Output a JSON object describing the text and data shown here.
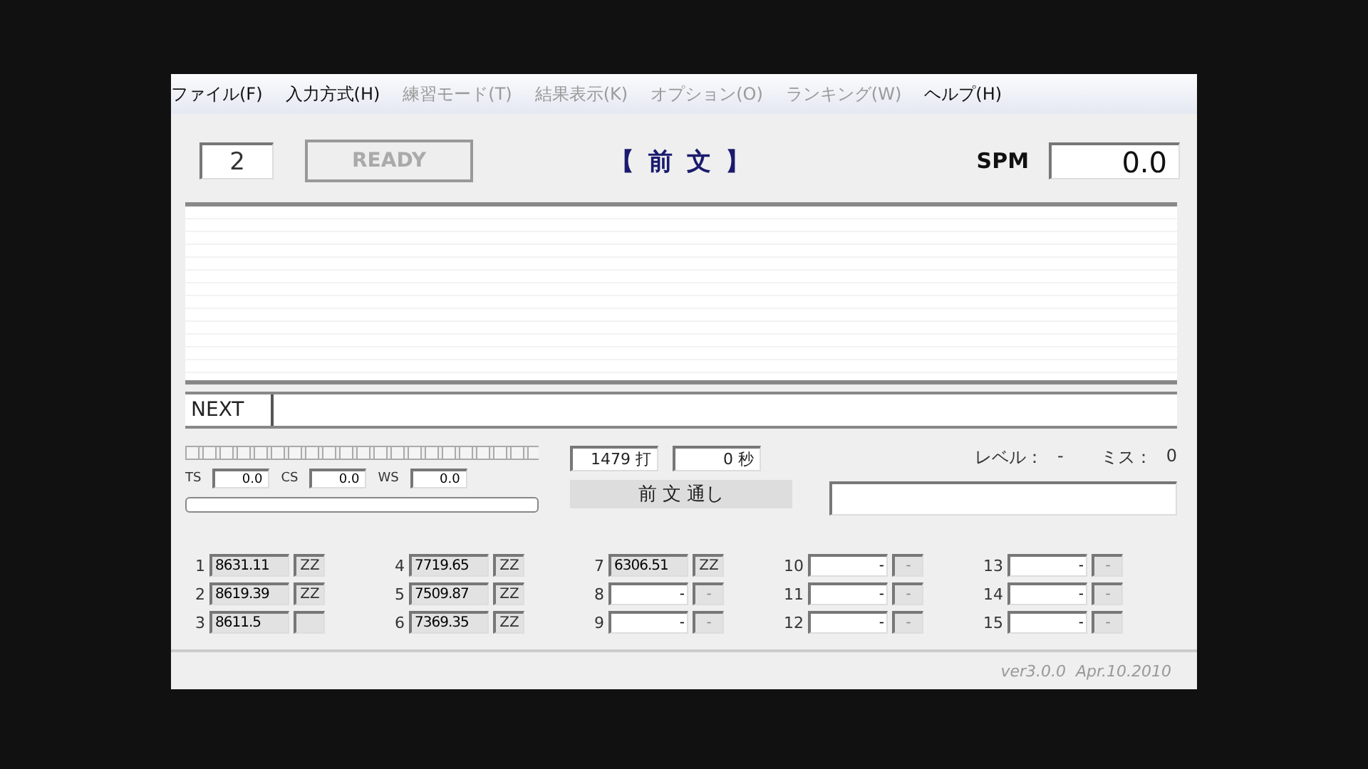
{
  "menu": [
    {
      "label": "ファイル(F)",
      "disabled": false
    },
    {
      "label": "入力方式(H)",
      "disabled": false
    },
    {
      "label": "練習モード(T)",
      "disabled": true
    },
    {
      "label": "結果表示(K)",
      "disabled": true
    },
    {
      "label": "オプション(O)",
      "disabled": true
    },
    {
      "label": "ランキング(W)",
      "disabled": true
    },
    {
      "label": "ヘルプ(H)",
      "disabled": false
    }
  ],
  "header": {
    "count": "2",
    "ready_button": {
      "label": "READY",
      "disabled": true
    },
    "title": "【 前 文 】",
    "spm_label": "SPM",
    "spm_value": "0.0"
  },
  "next_label": "NEXT",
  "speeds": [
    {
      "label": "TS",
      "value": "0.0"
    },
    {
      "label": "CS",
      "value": "0.0"
    },
    {
      "label": "WS",
      "value": "0.0"
    }
  ],
  "segment_meter": {
    "level": 0
  },
  "time_bar": {
    "level": 0
  },
  "keystrokes": "1479 打",
  "seconds": "0 秒",
  "mode_button": "前 文 通し",
  "level_label": "レベル：",
  "level_value": "-",
  "miss_label": "ミス：",
  "miss_value": "0",
  "scores": [
    {
      "rank": "1",
      "value": "8631.11",
      "grade": "ZZ",
      "kind": "record"
    },
    {
      "rank": "2",
      "value": "8619.39",
      "grade": "ZZ",
      "kind": "record"
    },
    {
      "rank": "3",
      "value": "8611.5",
      "kind": "record"
    },
    {
      "rank": "4",
      "value": "7719.65",
      "grade": "ZZ",
      "kind": "record"
    },
    {
      "rank": "5",
      "value": "7509.87",
      "grade": "ZZ",
      "kind": "record"
    },
    {
      "rank": "6",
      "value": "7369.35",
      "grade": "ZZ",
      "kind": "record"
    },
    {
      "rank": "7",
      "value": "6306.51",
      "grade": "ZZ",
      "kind": "record"
    },
    {
      "rank": "8",
      "value": "-",
      "grade": "-",
      "kind": "empty"
    },
    {
      "rank": "9",
      "value": "-",
      "grade": "-",
      "kind": "empty"
    },
    {
      "rank": "10",
      "value": "-",
      "grade": "-",
      "kind": "empty"
    },
    {
      "rank": "11",
      "value": "-",
      "grade": "-",
      "kind": "empty"
    },
    {
      "rank": "12",
      "value": "-",
      "grade": "-",
      "kind": "empty"
    },
    {
      "rank": "13",
      "value": "-",
      "grade": "-",
      "kind": "empty"
    },
    {
      "rank": "14",
      "value": "-",
      "grade": "-",
      "kind": "empty"
    },
    {
      "rank": "15",
      "value": "-",
      "grade": "-",
      "kind": "empty"
    }
  ],
  "version": "ver3.0.0  Apr.10.2010"
}
